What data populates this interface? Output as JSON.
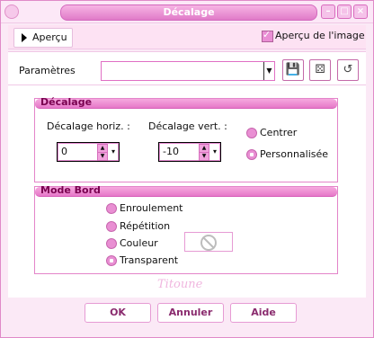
{
  "window": {
    "title": "Décalage"
  },
  "toolbar": {
    "preview_button": "Aperçu",
    "preview_checkbox": {
      "label": "Aperçu de l'image",
      "checked": true
    }
  },
  "presets": {
    "label": "Paramètres",
    "value": ""
  },
  "offset_group": {
    "title": "Décalage",
    "horiz": {
      "label": "Décalage horiz. :",
      "value": "0"
    },
    "vert": {
      "label": "Décalage vert. :",
      "value": "-10"
    },
    "options": [
      {
        "label": "Centrer",
        "selected": false
      },
      {
        "label": "Personnalisée",
        "selected": true
      }
    ]
  },
  "edge_group": {
    "title": "Mode Bord",
    "options": [
      {
        "label": "Enroulement",
        "selected": false
      },
      {
        "label": "Répétition",
        "selected": false
      },
      {
        "label": "Couleur",
        "selected": false
      },
      {
        "label": "Transparent",
        "selected": true
      }
    ]
  },
  "watermark": "Titoune",
  "footer": {
    "ok": "OK",
    "cancel": "Annuler",
    "help": "Aide"
  },
  "colors": {
    "accent": "#e678c8",
    "title_gradient_top": "#f7b4e4",
    "background": "#fbe9f6"
  }
}
